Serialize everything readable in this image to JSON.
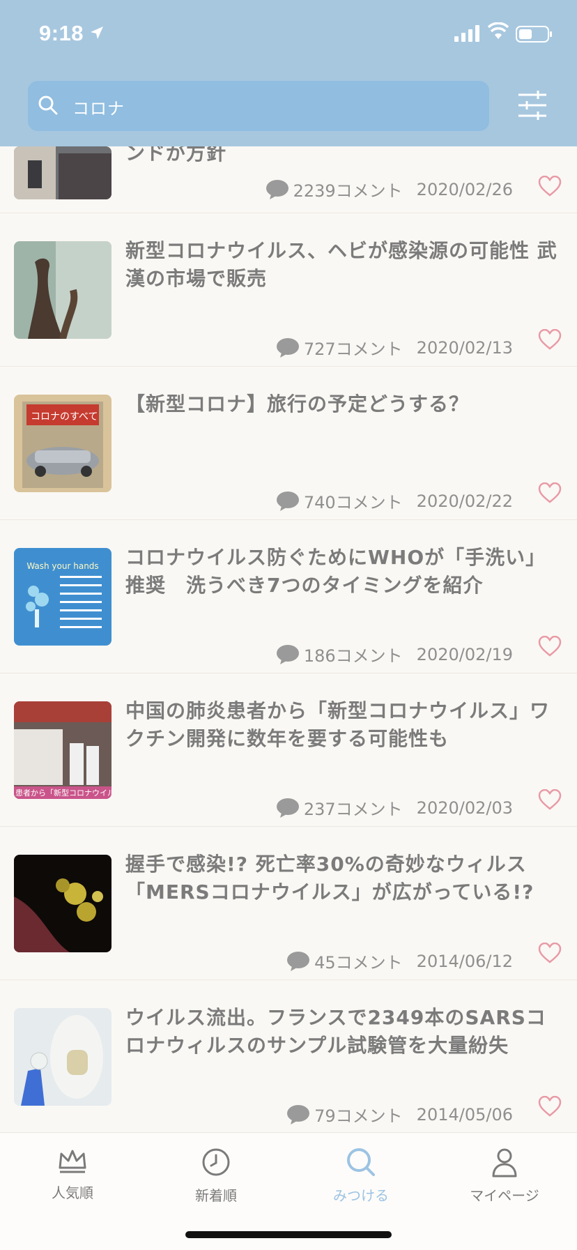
{
  "status_bar": {
    "time": "9:18"
  },
  "search": {
    "query": "コロナ"
  },
  "articles": [
    {
      "title": "ンドが方針",
      "comments": "2239コメント",
      "date": "2020/02/26"
    },
    {
      "title": "新型コロナウイルス、ヘビが感染源の可能性 武漢の市場で販売",
      "comments": "727コメント",
      "date": "2020/02/13"
    },
    {
      "title": "【新型コロナ】旅行の予定どうする？",
      "comments": "740コメント",
      "date": "2020/02/22"
    },
    {
      "title": "コロナウイルス防ぐためにWHOが「手洗い」推奨　洗うべき7つのタイミングを紹介",
      "comments": "186コメント",
      "date": "2020/02/19"
    },
    {
      "title": "中国の肺炎患者から「新型コロナウイルス」ワクチン開発に数年を要する可能性も",
      "comments": "237コメント",
      "date": "2020/02/03"
    },
    {
      "title": "握手で感染!? 死亡率30%の奇妙なウィルス「MERSコロナウイルス」が広がっている!?",
      "comments": "45コメント",
      "date": "2014/06/12"
    },
    {
      "title": "ウイルス流出。フランスで2349本のSARSコロナウィルスのサンプル試験管を大量紛失",
      "comments": "79コメント",
      "date": "2014/05/06"
    }
  ],
  "thumbs": {
    "t2_caption": "コロナのすべて",
    "t3_heading": "Wash your hands",
    "t4_caption": "患者から「新型コロナウイル"
  },
  "tabs": [
    {
      "label": "人気順",
      "icon": "crown-icon"
    },
    {
      "label": "新着順",
      "icon": "clock-icon"
    },
    {
      "label": "みつける",
      "icon": "search-icon",
      "active": true
    },
    {
      "label": "マイページ",
      "icon": "person-icon"
    }
  ],
  "colors": {
    "header": "#a7c7df",
    "accent": "#9cc3e3",
    "heart": "#e89aa6"
  }
}
